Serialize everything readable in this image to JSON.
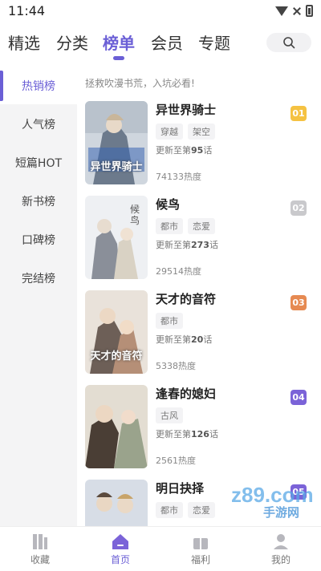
{
  "status_bar": {
    "time": "11:44"
  },
  "top_nav": {
    "tabs": [
      {
        "label": "精选"
      },
      {
        "label": "分类"
      },
      {
        "label": "榜单",
        "active": true
      },
      {
        "label": "会员"
      },
      {
        "label": "专题"
      }
    ],
    "search_icon": "search-icon"
  },
  "sidebar": {
    "items": [
      {
        "label": "热销榜",
        "active": true
      },
      {
        "label": "人气榜"
      },
      {
        "label": "短篇HOT"
      },
      {
        "label": "新书榜"
      },
      {
        "label": "口碑榜"
      },
      {
        "label": "完结榜"
      }
    ]
  },
  "content": {
    "subtitle": "拯救吹漫书荒，入坑必看!",
    "items": [
      {
        "title": "异世界骑士",
        "tags": [
          "穿越",
          "架空"
        ],
        "update_prefix": "更新至第",
        "update_num": "95",
        "update_suffix": "话",
        "heat": "74133热度",
        "rank": "01",
        "rank_color": "#f5c242",
        "cover_text": "异世界骑士"
      },
      {
        "title": "候鸟",
        "tags": [
          "都市",
          "恋爱"
        ],
        "update_prefix": "更新至第",
        "update_num": "273",
        "update_suffix": "话",
        "heat": "29514热度",
        "rank": "02",
        "rank_color": "#c9c9cc",
        "cover_text": "候鸟"
      },
      {
        "title": "天才的音符",
        "tags": [
          "都市"
        ],
        "update_prefix": "更新至第",
        "update_num": "20",
        "update_suffix": "话",
        "heat": "5338热度",
        "rank": "03",
        "rank_color": "#e68a52",
        "cover_text": "天才的音符"
      },
      {
        "title": "逢春的媳妇",
        "tags": [
          "古风"
        ],
        "update_prefix": "更新至第",
        "update_num": "126",
        "update_suffix": "话",
        "heat": "2561热度",
        "rank": "04",
        "rank_color": "#7b63d8",
        "cover_text": ""
      },
      {
        "title": "明日抉择",
        "tags": [
          "都市",
          "恋爱"
        ],
        "update_prefix": "",
        "update_num": "",
        "update_suffix": "",
        "heat": "",
        "rank": "05",
        "rank_color": "#7b63d8",
        "cover_text": ""
      }
    ]
  },
  "bottom_nav": {
    "items": [
      {
        "label": "收藏",
        "icon": "bookshelf-icon"
      },
      {
        "label": "首页",
        "icon": "home-icon",
        "active": true
      },
      {
        "label": "福利",
        "icon": "gift-icon"
      },
      {
        "label": "我的",
        "icon": "profile-icon"
      }
    ]
  },
  "watermark": {
    "text": "手游网",
    "logo": "z89.com"
  },
  "colors": {
    "accent": "#6b5fd6",
    "sidebar_bg": "#f4f4f5"
  }
}
